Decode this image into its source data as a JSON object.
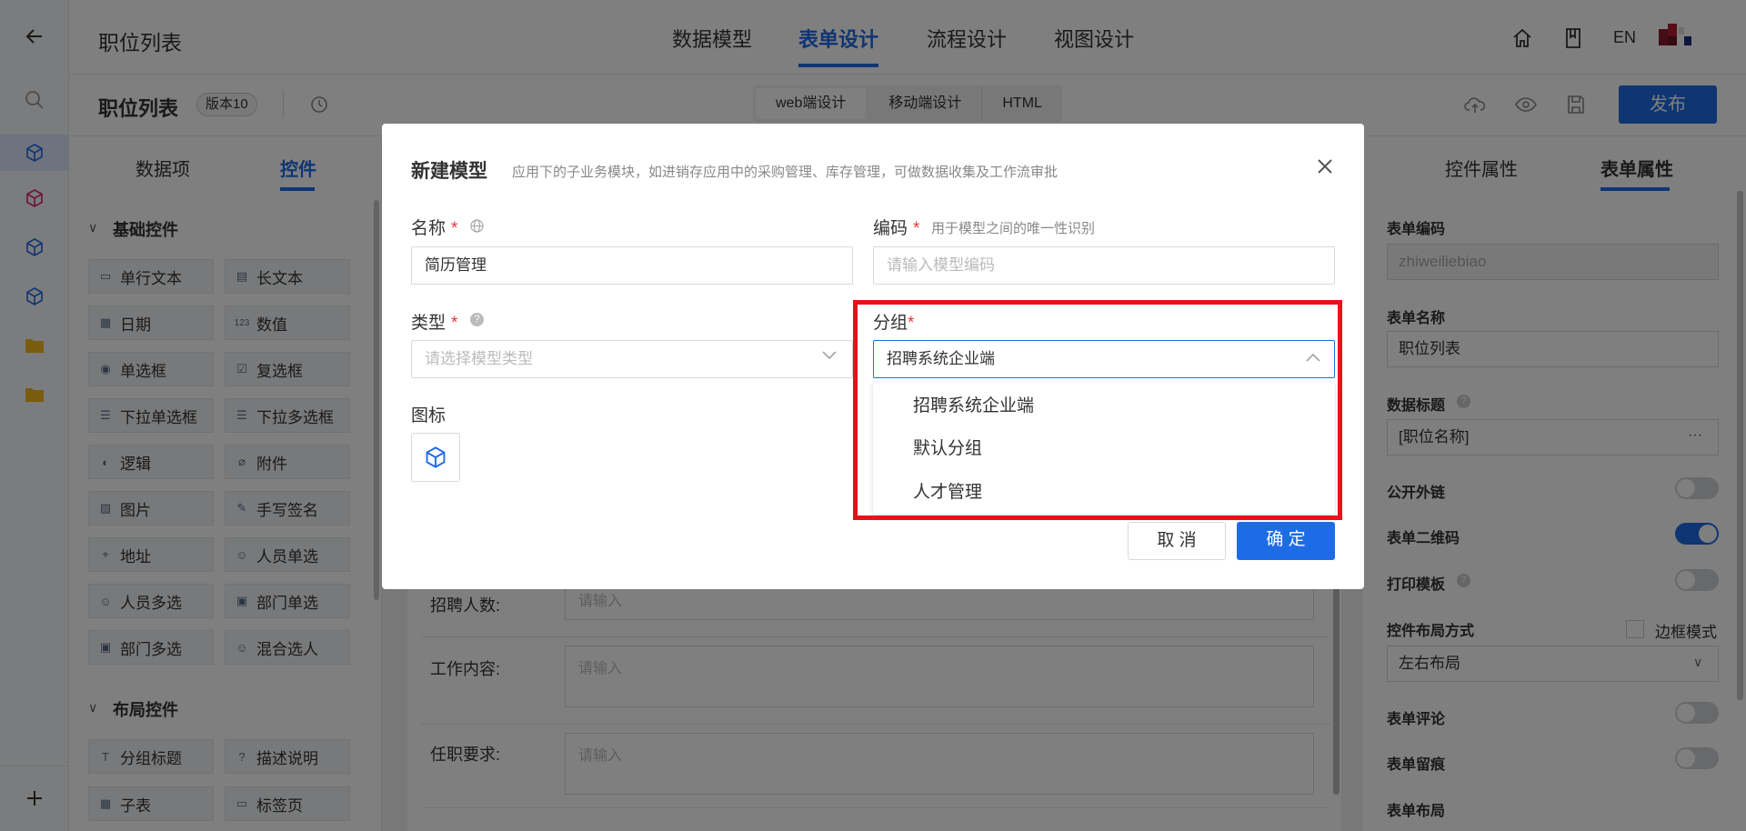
{
  "app": {
    "title": "职位列表",
    "top_tabs": [
      "数据模型",
      "表单设计",
      "流程设计",
      "视图设计"
    ],
    "lang": "EN"
  },
  "subbar": {
    "form_title": "职位列表",
    "version": "版本10",
    "segments": [
      "web端设计",
      "移动端设计",
      "HTML"
    ],
    "publish": "发布"
  },
  "left_panel": {
    "tabs": [
      "数据项",
      "控件"
    ],
    "basic_section": "基础控件",
    "controls": [
      "单行文本",
      "长文本",
      "日期",
      "数值",
      "单选框",
      "复选框",
      "下拉单选框",
      "下拉多选框",
      "逻辑",
      "附件",
      "图片",
      "手写签名",
      "地址",
      "人员单选",
      "人员多选",
      "部门单选",
      "部门多选",
      "混合选人"
    ],
    "layout_section": "布局控件",
    "layout_controls": [
      "分组标题",
      "描述说明",
      "子表",
      "标签页"
    ]
  },
  "form": {
    "rows": [
      {
        "label": "招聘人数:",
        "placeholder": "请输入"
      },
      {
        "label": "工作内容:",
        "placeholder": "请输入"
      },
      {
        "label": "任职要求:",
        "placeholder": "请输入"
      }
    ]
  },
  "right_panel": {
    "tabs": [
      "控件属性",
      "表单属性"
    ],
    "code_label": "表单编码",
    "code_value": "zhiweiliebiao",
    "name_label": "表单名称",
    "name_value": "职位列表",
    "data_title_label": "数据标题",
    "data_title_value": "[职位名称]",
    "more": "···",
    "public_link": "公开外链",
    "qr_code": "表单二维码",
    "print_template": "打印模板",
    "layout_label": "控件布局方式",
    "border_mode": "边框模式",
    "layout_value": "左右布局",
    "comment": "表单评论",
    "trace": "表单留痕",
    "form_layout": "表单布局"
  },
  "modal": {
    "title": "新建模型",
    "subtitle": "应用下的子业务模块，如进销存应用中的采购管理、库存管理，可做数据收集及工作流审批",
    "name_label": "名称",
    "name_value": "简历管理",
    "code_label": "编码",
    "code_hint": "用于模型之间的唯一性识别",
    "code_placeholder": "请输入模型编码",
    "type_label": "类型",
    "type_placeholder": "请选择模型类型",
    "group_label": "分组",
    "group_value": "招聘系统企业端",
    "group_options": [
      "招聘系统企业端",
      "默认分组",
      "人才管理"
    ],
    "icon_label": "图标",
    "required_mark": "*",
    "cancel": "取 消",
    "confirm": "确 定"
  },
  "colors": {
    "accent": "#1e6be6",
    "highlight": "#e8111b",
    "required": "#e8393a"
  }
}
